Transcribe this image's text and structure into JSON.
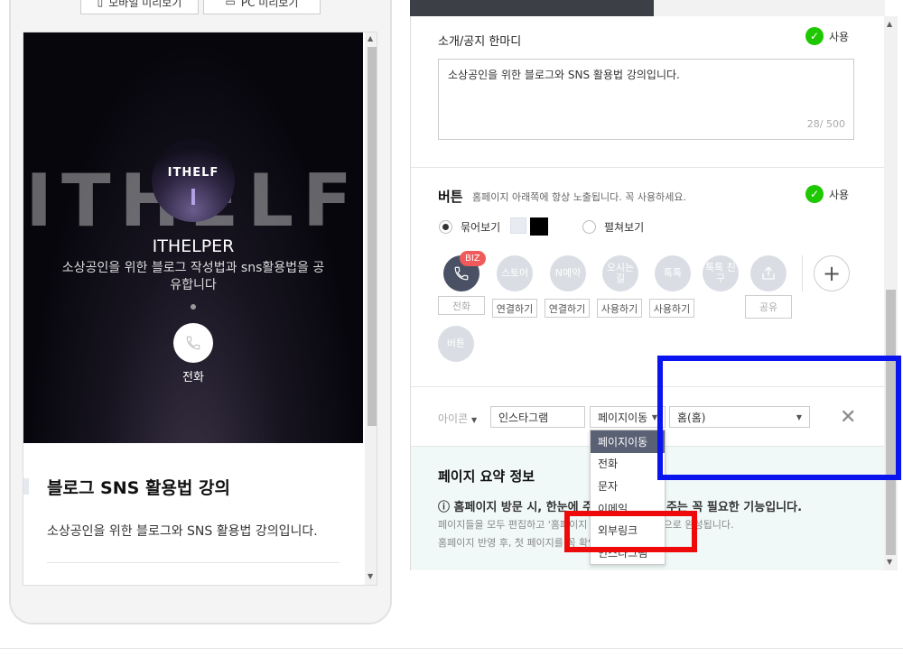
{
  "preview": {
    "mobile_button": "모바일 미리보기",
    "pc_button": "PC 미리보기",
    "hero_bg_text": "ITHELF",
    "logo_text": "ITHELF",
    "site_name": "ITHELPER",
    "site_desc": "소상공인을 위한 블로그 작성법과 sns활용법을 공유합니다",
    "call_label": "전화",
    "card_title": "블로그 SNS 활용법 강의",
    "card_desc": "소상공인을 위한 블로그와 SNS 활용법 강의입니다."
  },
  "intro": {
    "label": "소개/공지 한마디",
    "use_label": "사용",
    "text": "소상공인을 위한 블로그와 SNS 활용법 강의입니다.",
    "counter": "28/ 500"
  },
  "buttons": {
    "title": "버튼",
    "desc": "홈페이지 아래쪽에 항상 노출됩니다. 꼭 사용하세요.",
    "use_label": "사용",
    "radio_bundle": "묶어보기",
    "radio_spread": "펼쳐보기",
    "biz_badge": "BIZ",
    "icons": [
      {
        "label": "",
        "tag": "전화"
      },
      {
        "label": "스토어",
        "tag": "연결하기"
      },
      {
        "label": "N예약",
        "tag": "연결하기"
      },
      {
        "label": "오시는길",
        "tag": "사용하기"
      },
      {
        "label": "톡톡",
        "tag": "사용하기"
      },
      {
        "label": "톡톡 친구",
        "tag": ""
      },
      {
        "label": "",
        "tag": "공유"
      }
    ],
    "extra_icon": "버튼"
  },
  "link_row": {
    "icon_select": "아이콘",
    "name_value": "인스타그램",
    "action_select": "페이지이동",
    "target_select": "홈(홈)"
  },
  "dropdown": {
    "items": [
      "페이지이동",
      "전화",
      "문자",
      "이메일",
      "외부링크",
      "인스타그램"
    ]
  },
  "summary": {
    "title": "페이지 요약 정보",
    "line1": "ⓘ 홈페이지 방문 시, 한눈에 주요 정보를 보여주는 꼭 필요한 기능입니다.",
    "line2": "페이지들을 모두 편집하고 '홈페이지 반영'을 하면 자동으로 완성됩니다.",
    "line3": "홈페이지 반영 후, 첫 페이지를 꼭 확인해보세요!"
  },
  "colors": {
    "check_green": "#1ec800",
    "highlight_blue": "#0a14ee",
    "highlight_red": "#ee0a0a",
    "active_icon": "#4a5165"
  }
}
